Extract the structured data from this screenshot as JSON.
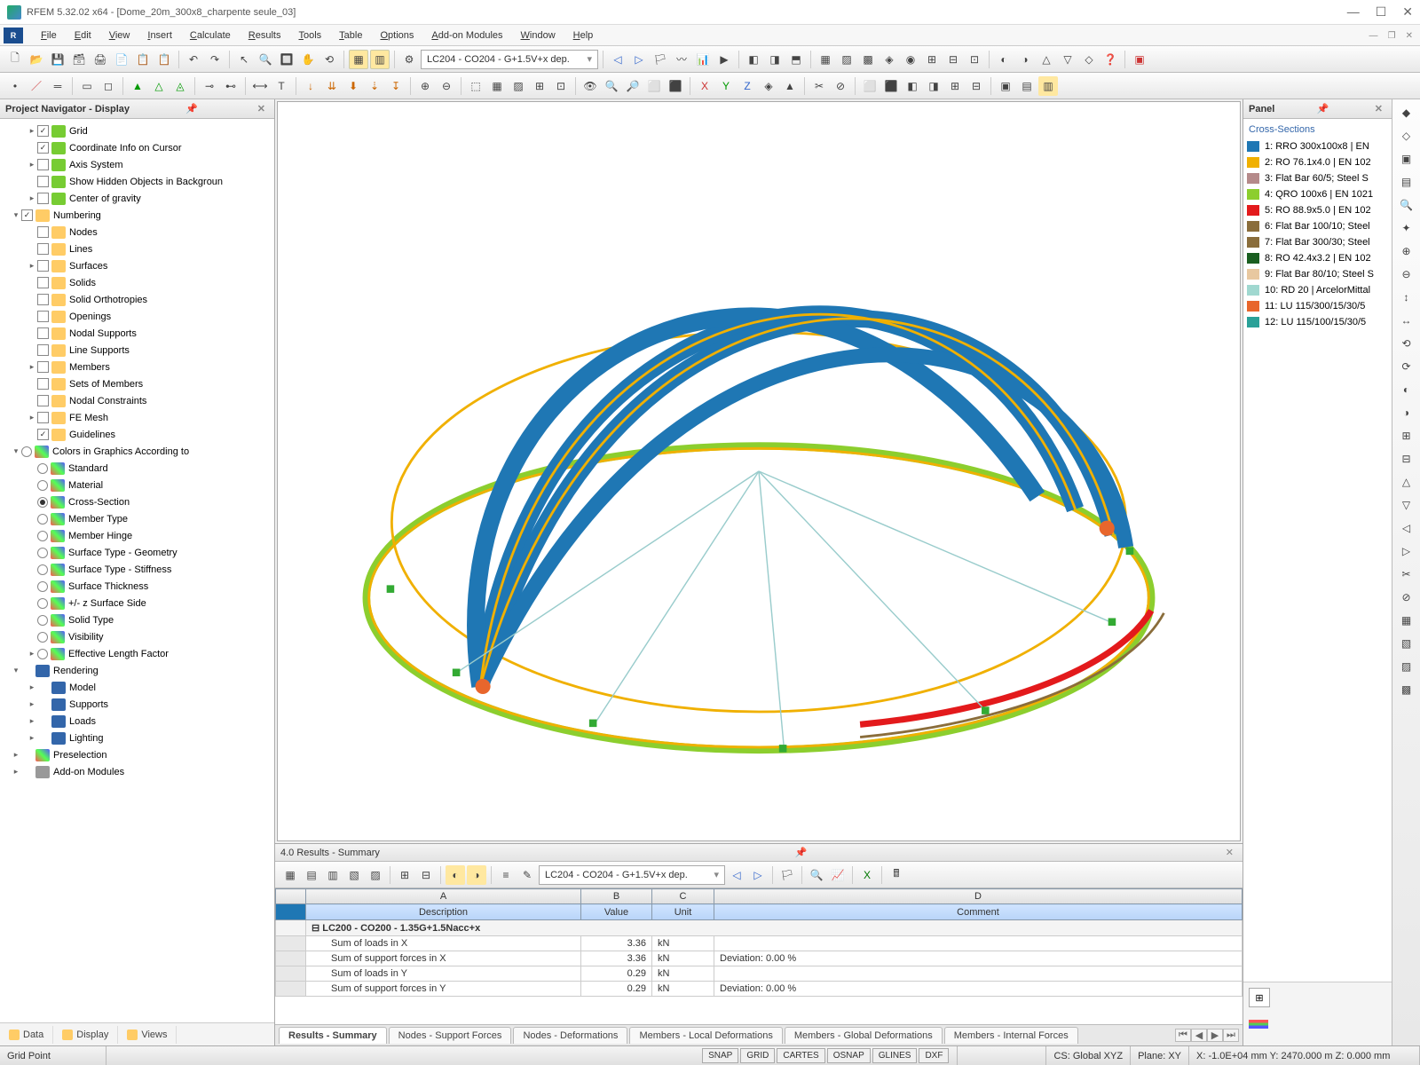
{
  "title": "RFEM 5.32.02 x64 - [Dome_20m_300x8_charpente seule_03]",
  "menus": [
    "File",
    "Edit",
    "View",
    "Insert",
    "Calculate",
    "Results",
    "Tools",
    "Table",
    "Options",
    "Add-on Modules",
    "Window",
    "Help"
  ],
  "loadcase_combo": "LC204 - CO204 - G+1.5V+x dep.",
  "navigator": {
    "title": "Project Navigator - Display",
    "footer_tabs": [
      "Data",
      "Display",
      "Views"
    ]
  },
  "tree": [
    {
      "d": 1,
      "exp": "+",
      "cb": true,
      "ic": "ic-green",
      "label": "Grid"
    },
    {
      "d": 1,
      "exp": "",
      "cb": true,
      "ic": "ic-green",
      "label": "Coordinate Info on Cursor"
    },
    {
      "d": 1,
      "exp": "+",
      "cb": false,
      "ic": "ic-green",
      "label": "Axis System"
    },
    {
      "d": 1,
      "exp": "",
      "cb": false,
      "ic": "ic-green",
      "label": "Show Hidden Objects in Backgroun"
    },
    {
      "d": 1,
      "exp": "+",
      "cb": false,
      "ic": "ic-green",
      "label": "Center of gravity"
    },
    {
      "d": 0,
      "exp": "-",
      "cb": true,
      "ic": "ic-num",
      "label": "Numbering"
    },
    {
      "d": 1,
      "exp": "",
      "cb": false,
      "ic": "ic-num",
      "label": "Nodes"
    },
    {
      "d": 1,
      "exp": "",
      "cb": false,
      "ic": "ic-num",
      "label": "Lines"
    },
    {
      "d": 1,
      "exp": "+",
      "cb": false,
      "ic": "ic-num",
      "label": "Surfaces"
    },
    {
      "d": 1,
      "exp": "",
      "cb": false,
      "ic": "ic-num",
      "label": "Solids"
    },
    {
      "d": 1,
      "exp": "",
      "cb": false,
      "ic": "ic-num",
      "label": "Solid Orthotropies"
    },
    {
      "d": 1,
      "exp": "",
      "cb": false,
      "ic": "ic-num",
      "label": "Openings"
    },
    {
      "d": 1,
      "exp": "",
      "cb": false,
      "ic": "ic-num",
      "label": "Nodal Supports"
    },
    {
      "d": 1,
      "exp": "",
      "cb": false,
      "ic": "ic-num",
      "label": "Line Supports"
    },
    {
      "d": 1,
      "exp": "+",
      "cb": false,
      "ic": "ic-num",
      "label": "Members"
    },
    {
      "d": 1,
      "exp": "",
      "cb": false,
      "ic": "ic-num",
      "label": "Sets of Members"
    },
    {
      "d": 1,
      "exp": "",
      "cb": false,
      "ic": "ic-num",
      "label": "Nodal Constraints"
    },
    {
      "d": 1,
      "exp": "+",
      "cb": false,
      "ic": "ic-num",
      "label": "FE Mesh"
    },
    {
      "d": 1,
      "exp": "",
      "cb": true,
      "ic": "ic-num",
      "label": "Guidelines"
    },
    {
      "d": 0,
      "exp": "-",
      "cb": "",
      "ic": "ic-col",
      "label": "Colors in Graphics According to",
      "rb": false
    },
    {
      "d": 1,
      "rb": false,
      "ic": "ic-col",
      "label": "Standard"
    },
    {
      "d": 1,
      "rb": false,
      "ic": "ic-col",
      "label": "Material"
    },
    {
      "d": 1,
      "rb": true,
      "ic": "ic-col",
      "label": "Cross-Section"
    },
    {
      "d": 1,
      "rb": false,
      "ic": "ic-col",
      "label": "Member Type"
    },
    {
      "d": 1,
      "rb": false,
      "ic": "ic-col",
      "label": "Member Hinge"
    },
    {
      "d": 1,
      "rb": false,
      "ic": "ic-col",
      "label": "Surface Type - Geometry"
    },
    {
      "d": 1,
      "rb": false,
      "ic": "ic-col",
      "label": "Surface Type - Stiffness"
    },
    {
      "d": 1,
      "rb": false,
      "ic": "ic-col",
      "label": "Surface Thickness"
    },
    {
      "d": 1,
      "rb": false,
      "ic": "ic-col",
      "label": "+/- z Surface Side"
    },
    {
      "d": 1,
      "rb": false,
      "ic": "ic-col",
      "label": "Solid Type"
    },
    {
      "d": 1,
      "rb": false,
      "ic": "ic-col",
      "label": "Visibility"
    },
    {
      "d": 1,
      "exp": "+",
      "rb": false,
      "ic": "ic-col",
      "label": "Effective Length Factor"
    },
    {
      "d": 0,
      "exp": "-",
      "cb": "",
      "ic": "ic-rend",
      "label": "Rendering"
    },
    {
      "d": 1,
      "exp": "+",
      "cb": "",
      "ic": "ic-rend",
      "label": "Model"
    },
    {
      "d": 1,
      "exp": "+",
      "cb": "",
      "ic": "ic-rend",
      "label": "Supports"
    },
    {
      "d": 1,
      "exp": "+",
      "cb": "",
      "ic": "ic-rend",
      "label": "Loads"
    },
    {
      "d": 1,
      "exp": "+",
      "cb": "",
      "ic": "ic-rend",
      "label": "Lighting"
    },
    {
      "d": 0,
      "exp": "+",
      "cb": "",
      "ic": "ic-col",
      "label": "Preselection"
    },
    {
      "d": 0,
      "exp": "+",
      "cb": "",
      "ic": "ic-mod",
      "label": "Add-on Modules"
    }
  ],
  "panel": {
    "title": "Panel",
    "section": "Cross-Sections",
    "legend": [
      {
        "c": "#1f77b4",
        "t": "1: RRO 300x100x8 | EN"
      },
      {
        "c": "#f0b000",
        "t": "2: RO 76.1x4.0 | EN 102"
      },
      {
        "c": "#b58a8a",
        "t": "3: Flat Bar 60/5; Steel S"
      },
      {
        "c": "#8cce2e",
        "t": "4: QRO 100x6 | EN 1021"
      },
      {
        "c": "#e31a1c",
        "t": "5: RO 88.9x5.0 | EN 102"
      },
      {
        "c": "#8a6d3b",
        "t": "6: Flat Bar 100/10; Steel"
      },
      {
        "c": "#8a6d3b",
        "t": "7: Flat Bar 300/30; Steel"
      },
      {
        "c": "#1a5e20",
        "t": "8: RO 42.4x3.2 | EN 102"
      },
      {
        "c": "#e8c8a0",
        "t": "9: Flat Bar 80/10; Steel S"
      },
      {
        "c": "#a0d8d0",
        "t": "10: RD 20 | ArcelorMittal"
      },
      {
        "c": "#e8662c",
        "t": "11: LU 115/300/15/30/5"
      },
      {
        "c": "#2aa198",
        "t": "12: LU 115/100/15/30/5"
      }
    ]
  },
  "results": {
    "title": "4.0 Results - Summary",
    "combo": "LC204 - CO204 - G+1.5V+x dep.",
    "col_letters": [
      "A",
      "B",
      "C",
      "D"
    ],
    "headers": [
      "Description",
      "Value",
      "Unit",
      "Comment"
    ],
    "group": "LC200 - CO200 - 1.35G+1.5Nacc+x",
    "rows": [
      {
        "desc": "Sum of loads in X",
        "val": "3.36",
        "unit": "kN",
        "comment": ""
      },
      {
        "desc": "Sum of support forces in X",
        "val": "3.36",
        "unit": "kN",
        "comment": "Deviation:  0.00 %"
      },
      {
        "desc": "Sum of loads in Y",
        "val": "0.29",
        "unit": "kN",
        "comment": ""
      },
      {
        "desc": "Sum of support forces in Y",
        "val": "0.29",
        "unit": "kN",
        "comment": "Deviation:  0.00 %"
      }
    ],
    "tabs": [
      "Results - Summary",
      "Nodes - Support Forces",
      "Nodes - Deformations",
      "Members - Local Deformations",
      "Members - Global Deformations",
      "Members - Internal Forces"
    ]
  },
  "status": {
    "left": "Grid Point",
    "snaps": [
      "SNAP",
      "GRID",
      "CARTES",
      "OSNAP",
      "GLINES",
      "DXF"
    ],
    "cs": "CS: Global XYZ",
    "plane": "Plane: XY",
    "coords": "X:  -1.0E+04 mm Y:  2470.000 m Z:  0.000 mm"
  }
}
